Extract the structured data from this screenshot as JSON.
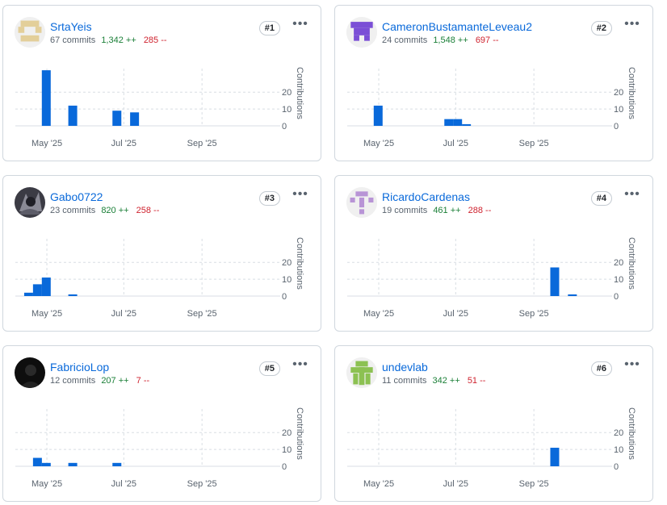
{
  "cards": [
    {
      "rank": "#1",
      "username": "SrtaYeis",
      "commits": "67 commits",
      "additions": "1,342 ++",
      "deletions": "285 --",
      "avatar_icon": "identicon-tan",
      "chart_data": {
        "type": "bar",
        "ylabel": "Contributions",
        "yticks": [
          "0",
          "10",
          "20"
        ],
        "ylim": [
          0,
          34
        ],
        "xticks": [
          "May '25",
          "Jul '25",
          "Sep '25"
        ],
        "bars": [
          {
            "week": "2025-04-27",
            "value": 33
          },
          {
            "week": "2025-05-18",
            "value": 12
          },
          {
            "week": "2025-06-22",
            "value": 9
          },
          {
            "week": "2025-07-06",
            "value": 8
          }
        ]
      }
    },
    {
      "rank": "#2",
      "username": "CameronBustamanteLeveau2",
      "commits": "24 commits",
      "additions": "1,548 ++",
      "deletions": "697 --",
      "avatar_icon": "identicon-purple",
      "chart_data": {
        "type": "bar",
        "ylabel": "Contributions",
        "yticks": [
          "0",
          "10",
          "20"
        ],
        "ylim": [
          0,
          34
        ],
        "xticks": [
          "May '25",
          "Jul '25",
          "Sep '25"
        ],
        "bars": [
          {
            "week": "2025-04-27",
            "value": 12
          },
          {
            "week": "2025-06-22",
            "value": 4
          },
          {
            "week": "2025-06-29",
            "value": 4
          },
          {
            "week": "2025-07-06",
            "value": 1
          }
        ]
      }
    },
    {
      "rank": "#3",
      "username": "Gabo0722",
      "commits": "23 commits",
      "additions": "820 ++",
      "deletions": "258 --",
      "avatar_icon": "photo-avatar-dark",
      "chart_data": {
        "type": "bar",
        "ylabel": "Contributions",
        "yticks": [
          "0",
          "10",
          "20"
        ],
        "ylim": [
          0,
          34
        ],
        "xticks": [
          "May '25",
          "Jul '25",
          "Sep '25"
        ],
        "bars": [
          {
            "week": "2025-04-13",
            "value": 2
          },
          {
            "week": "2025-04-20",
            "value": 7
          },
          {
            "week": "2025-04-27",
            "value": 11
          },
          {
            "week": "2025-05-18",
            "value": 1
          }
        ]
      }
    },
    {
      "rank": "#4",
      "username": "RicardoCardenas",
      "commits": "19 commits",
      "additions": "461 ++",
      "deletions": "288 --",
      "avatar_icon": "identicon-lavender",
      "chart_data": {
        "type": "bar",
        "ylabel": "Contributions",
        "yticks": [
          "0",
          "10",
          "20"
        ],
        "ylim": [
          0,
          34
        ],
        "xticks": [
          "May '25",
          "Jul '25",
          "Sep '25"
        ],
        "bars": [
          {
            "week": "2025-09-14",
            "value": 17
          },
          {
            "week": "2025-09-28",
            "value": 1
          }
        ]
      }
    },
    {
      "rank": "#5",
      "username": "FabricioLop",
      "commits": "12 commits",
      "additions": "207 ++",
      "deletions": "7 --",
      "avatar_icon": "photo-avatar-black",
      "chart_data": {
        "type": "bar",
        "ylabel": "Contributions",
        "yticks": [
          "0",
          "10",
          "20"
        ],
        "ylim": [
          0,
          34
        ],
        "xticks": [
          "May '25",
          "Jul '25",
          "Sep '25"
        ],
        "bars": [
          {
            "week": "2025-04-20",
            "value": 5
          },
          {
            "week": "2025-04-27",
            "value": 2
          },
          {
            "week": "2025-05-18",
            "value": 2
          },
          {
            "week": "2025-06-22",
            "value": 2
          }
        ]
      }
    },
    {
      "rank": "#6",
      "username": "undevlab",
      "commits": "11 commits",
      "additions": "342 ++",
      "deletions": "51 --",
      "avatar_icon": "identicon-green",
      "chart_data": {
        "type": "bar",
        "ylabel": "Contributions",
        "yticks": [
          "0",
          "10",
          "20"
        ],
        "ylim": [
          0,
          34
        ],
        "xticks": [
          "May '25",
          "Jul '25",
          "Sep '25"
        ],
        "bars": [
          {
            "week": "2025-09-14",
            "value": 11
          }
        ]
      }
    }
  ],
  "colors": {
    "bar": "#0969da",
    "link": "#0969da",
    "additions": "#1a7f37",
    "deletions": "#cf222e",
    "identicon-tan": "#e3cf9a",
    "identicon-purple": "#7b4fd6",
    "identicon-lavender": "#b894d6",
    "identicon-green": "#8cc152"
  }
}
